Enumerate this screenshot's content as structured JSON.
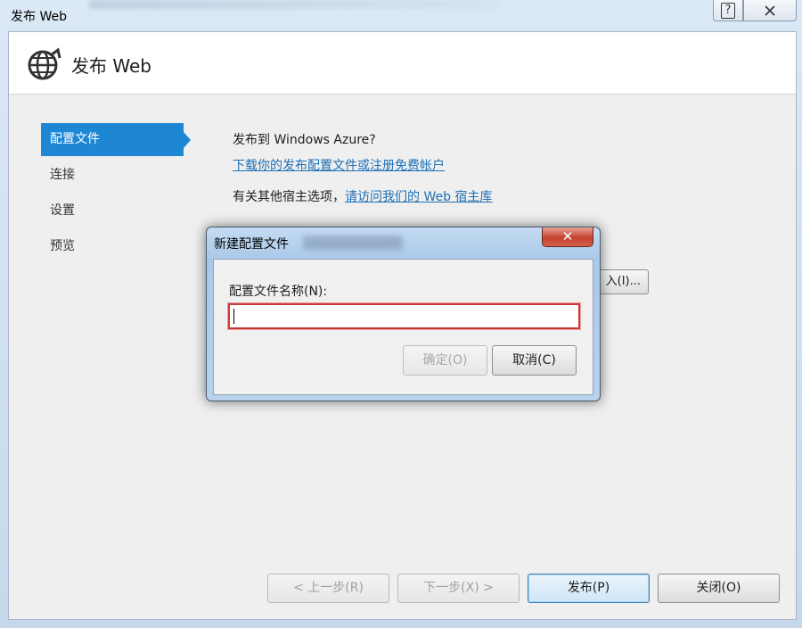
{
  "window": {
    "title": "发布 Web"
  },
  "header": {
    "title": "发布 Web",
    "icon": "globe-arrow-icon"
  },
  "sidebar": {
    "items": [
      {
        "label": "配置文件",
        "active": true
      },
      {
        "label": "连接",
        "active": false
      },
      {
        "label": "设置",
        "active": false
      },
      {
        "label": "预览",
        "active": false
      }
    ]
  },
  "main": {
    "azure_heading": "发布到 Windows Azure?",
    "azure_link": "下载你的发布配置文件或注册免费帐户",
    "other_hosts_text": "有关其他宿主选项，",
    "other_hosts_link": "请访问我们的 Web 宿主库",
    "import_button": "入(I)..."
  },
  "footer": {
    "prev": "< 上一步(R)",
    "next": "下一步(X) >",
    "publish": "发布(P)",
    "close": "关闭(O)"
  },
  "dialog": {
    "title": "新建配置文件",
    "close_glyph": "✕",
    "label": "配置文件名称(N):",
    "input_value": "",
    "ok": "确定(O)",
    "cancel": "取消(C)"
  },
  "colors": {
    "accent": "#1e87d4",
    "link": "#1e6fb4",
    "input_error_border": "#c93a3a",
    "close_button": "#c5422f"
  }
}
